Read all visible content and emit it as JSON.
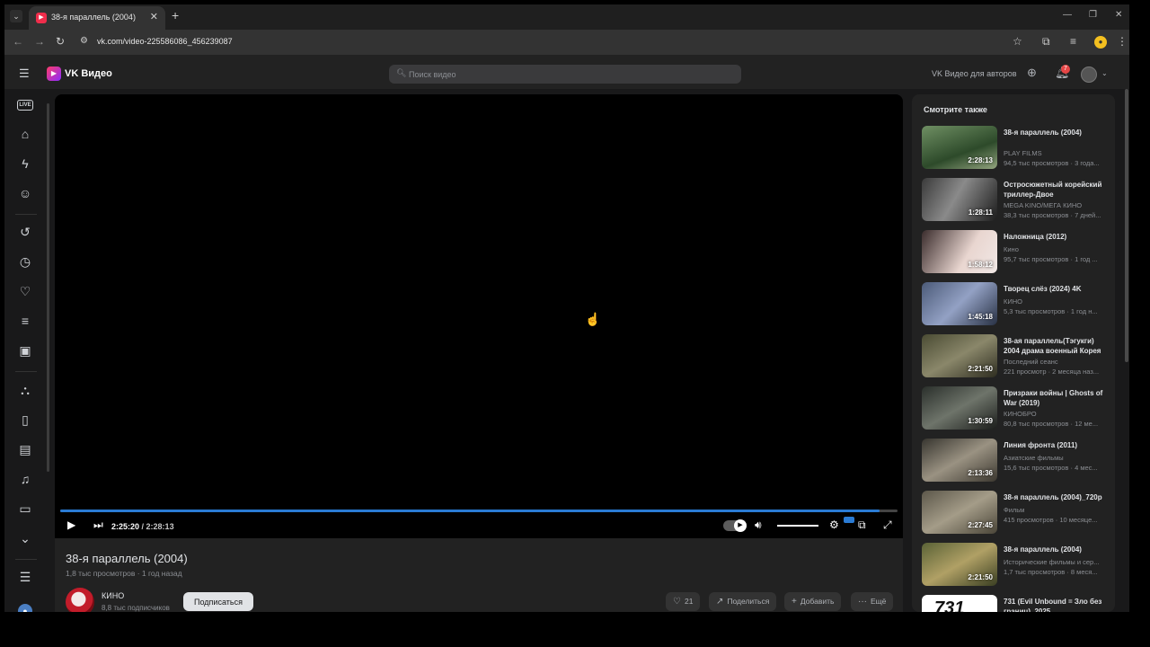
{
  "browser": {
    "tab_title": "38-я параллель (2004)",
    "url": "vk.com/video-225586086_456239087"
  },
  "header": {
    "logo": "VK Видео",
    "search_placeholder": "Поиск видео",
    "authors_link": "VK Видео для авторов",
    "notifications_count": "7"
  },
  "rail": {
    "live_label": "LIVE"
  },
  "player": {
    "current_time": "2:25:20",
    "separator": " / ",
    "duration": "2:28:13",
    "progress_fraction": 0.979,
    "volume_fraction": 1.0,
    "accent_color": "#2a7bd4"
  },
  "video": {
    "title": "38-я параллель (2004)",
    "views": "1,8 тыс просмотров",
    "age": "1 год назад",
    "channel_name": "КИНО",
    "subscribers": "8,8 тыс подписчиков",
    "subscribe_label": "Подписаться",
    "likes": "21",
    "share_label": "Поделиться",
    "add_label": "Добавить",
    "more_label": "Ещё"
  },
  "sidebar": {
    "title": "Смотрите также",
    "items": [
      {
        "title": "38-я параллель (2004)",
        "channel": "PLAY FILMS",
        "stats": "94,5 тыс просмотров · 3 года...",
        "duration": "2:28:13"
      },
      {
        "title": "Остросюжетный корейский триллер-Двое",
        "channel": "MEGA KINO/МЕГА КИНО",
        "stats": "38,3 тыс просмотров · 7 дней...",
        "duration": "1:28:11"
      },
      {
        "title": "Наложница (2012)",
        "channel": "Кино",
        "stats": "95,7 тыс просмотров · 1 год ...",
        "duration": "1:58:12"
      },
      {
        "title": "Творец слёз (2024) 4K",
        "channel": "КИНО",
        "stats": "5,3 тыс просмотров · 1 год н...",
        "duration": "1:45:18"
      },
      {
        "title": "38-ая параллель(Тэгукги) 2004 драма военный Корея",
        "channel": "Последний сеанс",
        "stats": "221 просмотр · 2 месяца наз...",
        "duration": "2:21:50"
      },
      {
        "title": "Призраки войны | Ghosts of War (2019)",
        "channel": "КИНОБРО",
        "stats": "80,8 тыс просмотров · 12 ме...",
        "duration": "1:30:59"
      },
      {
        "title": "Линия фронта (2011)",
        "channel": "Азиатские фильмы",
        "stats": "15,6 тыс просмотров · 4 мес...",
        "duration": "2:13:36"
      },
      {
        "title": "38-я параллель (2004)_720p",
        "channel": "Фильм",
        "stats": "415 просмотров · 10 месяце...",
        "duration": "2:27:45"
      },
      {
        "title": "38-я параллель (2004)",
        "channel": "Исторические фильмы и сер...",
        "stats": "1,7 тыс просмотров · 8 меся...",
        "duration": "2:21:50"
      },
      {
        "title": "731 (Evil Unbound = Зло без границ), 2025",
        "channel": "",
        "stats": "",
        "duration": "",
        "thumb_text": "731"
      }
    ]
  }
}
